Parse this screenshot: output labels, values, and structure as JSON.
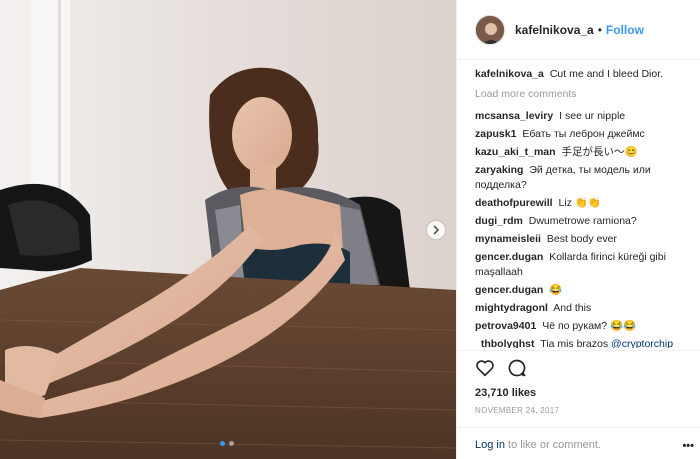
{
  "post": {
    "username": "kafelnikova_a",
    "separator": "•",
    "follow_label": "Follow",
    "caption_user": "kafelnikova_a",
    "caption_text": "Cut me and I bleed Dior.",
    "load_more": "Load more comments",
    "likes": "23,710 likes",
    "date": "NOVEMBER 24, 2017",
    "login_link": "Log in",
    "login_rest": " to like or comment.",
    "more_icon": "•••"
  },
  "comments": [
    {
      "user": "mcsansa_leviry",
      "text": "I see ur nipple"
    },
    {
      "user": "zapusk1",
      "text": "Ебать ты леброн джеймс"
    },
    {
      "user": "kazu_aki_t_man",
      "text": "手足が長い〜😊"
    },
    {
      "user": "zaryaking",
      "text": "Эй детка, ты модель или подделка?"
    },
    {
      "user": "deathofpurewill",
      "text": "Liz 👏👏"
    },
    {
      "user": "dugi_rdm",
      "text": "Dwumetrowe ramiona?"
    },
    {
      "user": "mynameisleii",
      "text": "Best body ever"
    },
    {
      "user": "gencer.dugan",
      "text": "Kollarda firinci küreği gibi maşallaah"
    },
    {
      "user": "gencer.dugan",
      "text": "😂"
    },
    {
      "user": "mightydragonl",
      "text": "And this"
    },
    {
      "user": "petrova9401",
      "text": "Чё по рукам? 😂😂"
    },
    {
      "user": "_thbolyghst",
      "text": "Tia mis brazos",
      "mention": "@cryptorchip"
    }
  ],
  "icons": {
    "heart": "heart-icon",
    "comment": "comment-icon",
    "next": "chevron-right-icon"
  },
  "colors": {
    "accent": "#3897f0",
    "link": "#003569",
    "muted": "#999999"
  }
}
